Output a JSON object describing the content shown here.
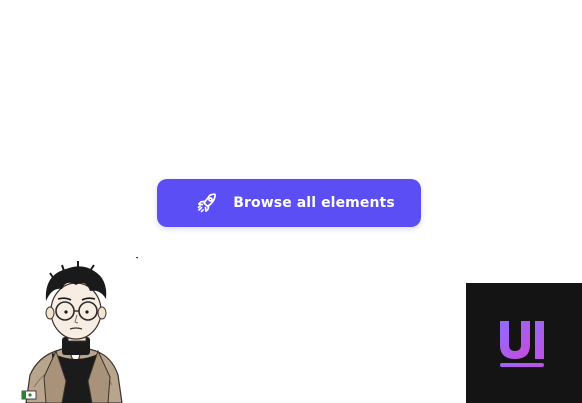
{
  "cta": {
    "label": "Browse all elements",
    "icon": "rocket-icon",
    "background_color": "#5b4ef5",
    "text_color": "#ffffff"
  },
  "avatar": {
    "icon": "cartoon-avatar"
  },
  "logo": {
    "text": "UI",
    "background_color": "#141414",
    "gradient_start": "#8f6cff",
    "gradient_end": "#c84cdc"
  }
}
